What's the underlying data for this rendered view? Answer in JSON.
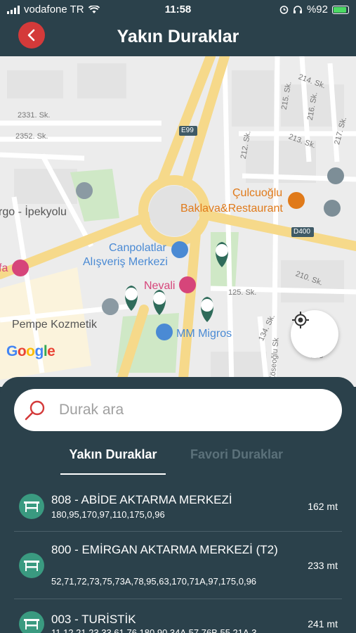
{
  "status_bar": {
    "carrier": "vodafone TR",
    "time": "11:58",
    "battery": "%92"
  },
  "header": {
    "title": "Yakın Duraklar"
  },
  "map": {
    "streets": [
      "214. Sk.",
      "215. Sk.",
      "216. Sk.",
      "2331. Sk.",
      "2352. Sk.",
      "E99",
      "212. Sk.",
      "213. Sk.",
      "217. Sk.",
      "D400",
      "210. Sk.",
      "125. Sk.",
      "134. Sk.",
      "Köseoğlu Sk",
      "135"
    ],
    "pois": {
      "ipekyolu": "rgo - İpekyolu",
      "cafe": "fa",
      "cilcuoglu_1": "Çulcuoğlu",
      "cilcuoglu_2": "Baklava&Restaurant",
      "canpolatlar_1": "Canpolatlar",
      "canpolatlar_2": "Alışveriş Merkezi",
      "nevali": "Nevali",
      "pempe": "Pempe Kozmetik",
      "migros": "MM Migros"
    },
    "google": "Google",
    "colors": {
      "road_major": "#f6d98a",
      "road_minor": "#ffffff",
      "park": "#cfe8c6",
      "poi_blue": "#4a8ad4",
      "poi_orange": "#e07a1a",
      "poi_pink": "#d6457a"
    }
  },
  "search": {
    "placeholder": "Durak ara"
  },
  "tabs": [
    {
      "label": "Yakın Duraklar",
      "active": true
    },
    {
      "label": "Favori Duraklar",
      "active": false
    }
  ],
  "stops": [
    {
      "name": "808 -  ABİDE AKTARMA MERKEZİ",
      "lines": "180,95,170,97,110,175,0,96",
      "distance": "162 mt"
    },
    {
      "name": "800 -  EMİRGAN AKTARMA MERKEZİ (T2)",
      "lines": "52,71,72,73,75,73A,78,95,63,170,71A,97,175,0,96",
      "distance": "233 mt"
    },
    {
      "name": "003 - TURİSTİK",
      "lines": "11,12,21,23,33,61,76,180,90,34A,57,76B,55,21A,3",
      "distance": "241 mt"
    }
  ],
  "icons": {
    "back": "chevron-left-icon",
    "search": "search-icon",
    "locate": "my-location-icon",
    "stop": "bus-stop-icon"
  }
}
